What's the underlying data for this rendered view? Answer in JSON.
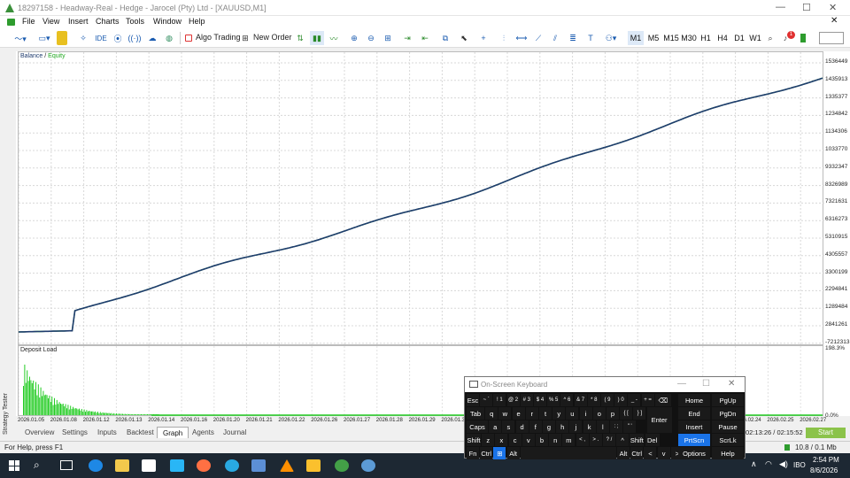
{
  "window": {
    "title": "18297158 - Headway-Real - Hedge - Jarocel (Pty) Ltd - [XAUUSD,M1]",
    "min": "—",
    "max": "☐",
    "close": "✕"
  },
  "menu": [
    "File",
    "View",
    "Insert",
    "Charts",
    "Tools",
    "Window",
    "Help"
  ],
  "toolbar": {
    "algo_trading": "Algo Trading",
    "new_order": "New Order",
    "ide": "IDE",
    "timeframes": [
      "M1",
      "M5",
      "M15",
      "M30",
      "H1",
      "H4",
      "D1",
      "W1"
    ],
    "active_timeframe": "M1",
    "notification_count": "1"
  },
  "chart": {
    "legend_balance": "Balance",
    "legend_sep": "/",
    "legend_equity": "Equity",
    "sub_title": "Deposit Load",
    "colors": {
      "balance": "#1f3c6e",
      "equity": "#22aa22",
      "load": "#22cc22"
    },
    "y_ticks": [
      "1536449",
      "1435913",
      "1335377",
      "1234842",
      "1134306",
      "1033770",
      "9332347",
      "8326989",
      "7321631",
      "6316273",
      "5310915",
      "4305557",
      "3300199",
      "2294841",
      "1289484",
      "2841261",
      "-7212313"
    ],
    "sub_ticks": [
      "198.3%",
      "0.0%"
    ],
    "x_ticks": [
      "2026.01.05",
      "2026.01.08",
      "2026.01.12",
      "2026.01.13",
      "2026.01.14",
      "2026.01.16",
      "2026.01.20",
      "2026.01.21",
      "2026.01.22",
      "2026.01.26",
      "2026.01.27",
      "2026.01.28",
      "2026.01.29",
      "2026.01.30",
      "2026.02.03",
      "2026.02.05",
      "2026.02.06",
      "2026.02.10",
      "2026.02.12",
      "2026.02.16",
      "2026.02.18",
      "2026.02.20",
      "2026.02.24",
      "2026.02.25",
      "2026.02.27"
    ]
  },
  "tester": {
    "tabs": [
      "Overview",
      "Settings",
      "Inputs",
      "Backtest",
      "Graph",
      "Agents",
      "Journal"
    ],
    "active_tab": "Graph",
    "side_label": "Strategy Tester",
    "time": "02:13:26 / 02:15:52",
    "start": "Start"
  },
  "status": {
    "help": "For Help, press F1",
    "net": "10.8 / 0.1 Mb"
  },
  "osk": {
    "title": "On-Screen Keyboard",
    "rows": [
      [
        "Esc",
        "~ `",
        "! 1",
        "@ 2",
        "# 3",
        "$ 4",
        "% 5",
        "^ 6",
        "& 7",
        "* 8",
        "( 9",
        ") 0",
        "_ -",
        "+ =",
        "⌫"
      ],
      [
        "Tab",
        "q",
        "w",
        "e",
        "r",
        "t",
        "y",
        "u",
        "i",
        "o",
        "p",
        "{ [",
        "} ]",
        "Enter"
      ],
      [
        "Caps",
        "a",
        "s",
        "d",
        "f",
        "g",
        "h",
        "j",
        "k",
        "l",
        ": ;",
        "\" '"
      ],
      [
        "Shift",
        "z",
        "x",
        "c",
        "v",
        "b",
        "n",
        "m",
        "< ,",
        "> .",
        "? /",
        "^",
        "Shift",
        "Del"
      ],
      [
        "Fn",
        "Ctrl",
        "⊞",
        "Alt",
        "",
        "Alt",
        "Ctrl",
        "<",
        "v",
        ">",
        "▣"
      ]
    ],
    "side": [
      "Home",
      "PgUp",
      "End",
      "PgDn",
      "Insert",
      "Pause",
      "PrtScn",
      "ScrLk",
      "Options",
      "Help"
    ]
  },
  "taskbar": {
    "time": "2:54 PM",
    "date": "8/6/2026",
    "lang": "IBO"
  }
}
